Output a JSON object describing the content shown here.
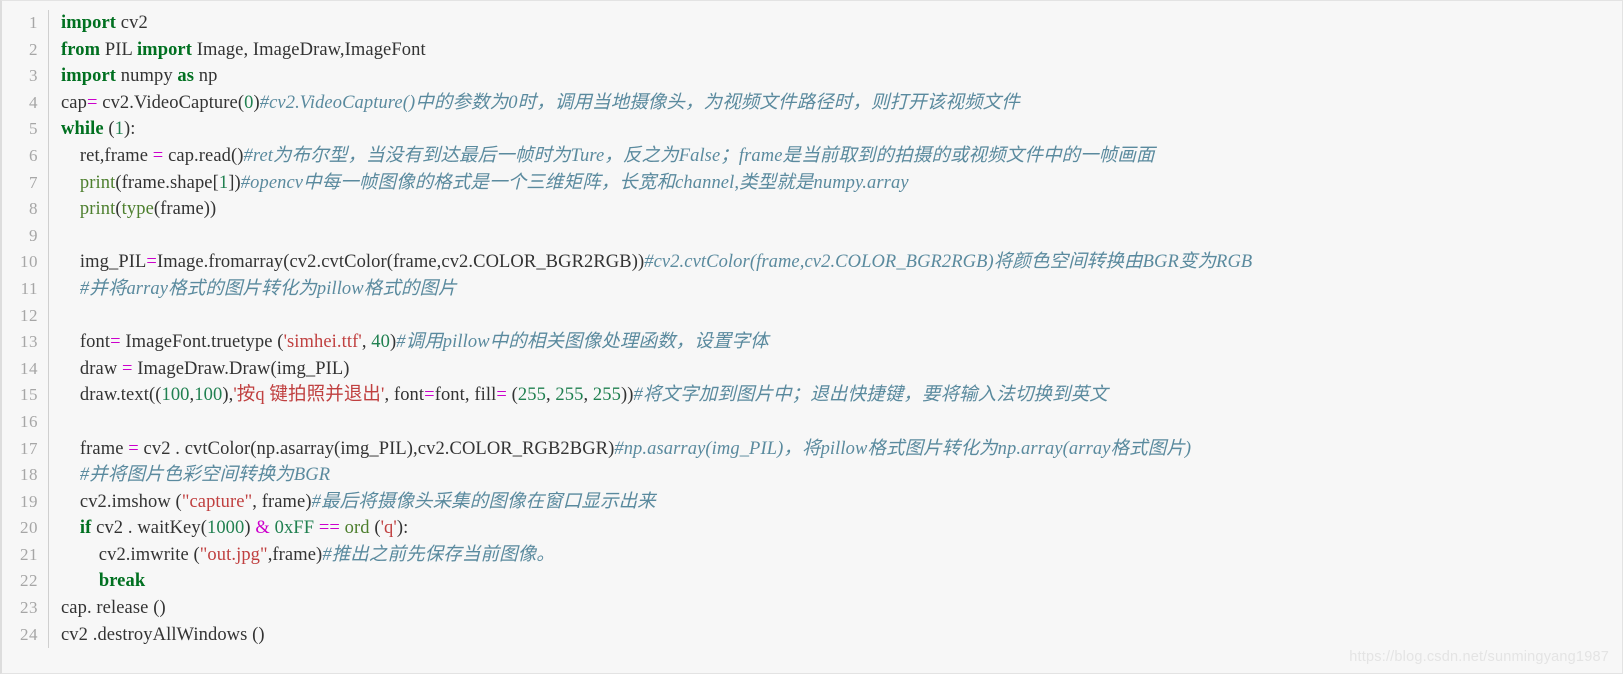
{
  "editor": {
    "language": "python",
    "total_lines": 24,
    "background_color": "#f7f7f7",
    "gutter_color": "#a6a6a6",
    "colors": {
      "keyword": "#007020",
      "builtin": "#4d7f2e",
      "number": "#208050",
      "string": "#c04040",
      "operator": "#cc00cc",
      "comment": "#5a8a9e",
      "plain": "#333333"
    },
    "line_numbers": [
      "1",
      "2",
      "3",
      "4",
      "5",
      "6",
      "7",
      "8",
      "9",
      "10",
      "11",
      "12",
      "13",
      "14",
      "15",
      "16",
      "17",
      "18",
      "19",
      "20",
      "21",
      "22",
      "23",
      "24"
    ],
    "lines": [
      {
        "n": "1",
        "tokens": [
          {
            "t": "import",
            "c": "kw"
          },
          {
            "t": " cv2",
            "c": "pl"
          }
        ]
      },
      {
        "n": "2",
        "tokens": [
          {
            "t": "from",
            "c": "kw"
          },
          {
            "t": " PIL ",
            "c": "pl"
          },
          {
            "t": "import",
            "c": "kw"
          },
          {
            "t": " Image, ImageDraw,ImageFont",
            "c": "pl"
          }
        ]
      },
      {
        "n": "3",
        "tokens": [
          {
            "t": "import",
            "c": "kw"
          },
          {
            "t": " numpy ",
            "c": "pl"
          },
          {
            "t": "as",
            "c": "kw"
          },
          {
            "t": " np",
            "c": "pl"
          }
        ]
      },
      {
        "n": "4",
        "tokens": [
          {
            "t": "cap",
            "c": "pl"
          },
          {
            "t": "=",
            "c": "op"
          },
          {
            "t": " cv2.VideoCapture(",
            "c": "pl"
          },
          {
            "t": "0",
            "c": "num"
          },
          {
            "t": ")",
            "c": "pl"
          },
          {
            "t": "#cv2.VideoCapture()中的参数为0时，调用当地摄像头，为视频文件路径时，则打开该视频文件",
            "c": "cmt"
          }
        ]
      },
      {
        "n": "5",
        "tokens": [
          {
            "t": "while",
            "c": "kw"
          },
          {
            "t": " (",
            "c": "pl"
          },
          {
            "t": "1",
            "c": "num"
          },
          {
            "t": "):",
            "c": "pl"
          }
        ]
      },
      {
        "n": "6",
        "tokens": [
          {
            "t": "    ret,frame ",
            "c": "pl"
          },
          {
            "t": "=",
            "c": "op"
          },
          {
            "t": " cap.read()",
            "c": "pl"
          },
          {
            "t": "#ret为布尔型，当没有到达最后一帧时为Ture，反之为False；frame是当前取到的拍摄的或视频文件中的一帧画面",
            "c": "cmt"
          }
        ]
      },
      {
        "n": "7",
        "tokens": [
          {
            "t": "    ",
            "c": "pl"
          },
          {
            "t": "print",
            "c": "bi"
          },
          {
            "t": "(frame.shape[",
            "c": "pl"
          },
          {
            "t": "1",
            "c": "num"
          },
          {
            "t": "])",
            "c": "pl"
          },
          {
            "t": "#opencv中每一帧图像的格式是一个三维矩阵，长宽和channel,类型就是numpy.array",
            "c": "cmt"
          }
        ]
      },
      {
        "n": "8",
        "tokens": [
          {
            "t": "    ",
            "c": "pl"
          },
          {
            "t": "print",
            "c": "bi"
          },
          {
            "t": "(",
            "c": "pl"
          },
          {
            "t": "type",
            "c": "bi"
          },
          {
            "t": "(frame))",
            "c": "pl"
          }
        ]
      },
      {
        "n": "9",
        "tokens": []
      },
      {
        "n": "10",
        "tokens": [
          {
            "t": "    img_PIL",
            "c": "pl"
          },
          {
            "t": "=",
            "c": "op"
          },
          {
            "t": "Image.fromarray(cv2.cvtColor(frame,cv2.COLOR_BGR2RGB))",
            "c": "pl"
          },
          {
            "t": "#cv2.cvtColor(frame,cv2.COLOR_BGR2RGB)将颜色空间转换由BGR变为RGB",
            "c": "cmt"
          }
        ]
      },
      {
        "n": "11",
        "tokens": [
          {
            "t": "    ",
            "c": "pl"
          },
          {
            "t": "#并将array格式的图片转化为pillow格式的图片",
            "c": "cmt"
          }
        ]
      },
      {
        "n": "12",
        "tokens": []
      },
      {
        "n": "13",
        "tokens": [
          {
            "t": "    font",
            "c": "pl"
          },
          {
            "t": "=",
            "c": "op"
          },
          {
            "t": " ImageFont.truetype (",
            "c": "pl"
          },
          {
            "t": "'simhei.ttf'",
            "c": "str"
          },
          {
            "t": ", ",
            "c": "pl"
          },
          {
            "t": "40",
            "c": "num"
          },
          {
            "t": ")",
            "c": "pl"
          },
          {
            "t": "#调用pillow中的相关图像处理函数，设置字体",
            "c": "cmt"
          }
        ]
      },
      {
        "n": "14",
        "tokens": [
          {
            "t": "    draw ",
            "c": "pl"
          },
          {
            "t": "=",
            "c": "op"
          },
          {
            "t": " ImageDraw.Draw(img_PIL)",
            "c": "pl"
          }
        ]
      },
      {
        "n": "15",
        "tokens": [
          {
            "t": "    draw.text((",
            "c": "pl"
          },
          {
            "t": "100",
            "c": "num"
          },
          {
            "t": ",",
            "c": "pl"
          },
          {
            "t": "100",
            "c": "num"
          },
          {
            "t": "),",
            "c": "pl"
          },
          {
            "t": "'按q 键拍照并退出'",
            "c": "str"
          },
          {
            "t": ", font",
            "c": "pl"
          },
          {
            "t": "=",
            "c": "op"
          },
          {
            "t": "font, fill",
            "c": "pl"
          },
          {
            "t": "=",
            "c": "op"
          },
          {
            "t": " (",
            "c": "pl"
          },
          {
            "t": "255",
            "c": "num"
          },
          {
            "t": ", ",
            "c": "pl"
          },
          {
            "t": "255",
            "c": "num"
          },
          {
            "t": ", ",
            "c": "pl"
          },
          {
            "t": "255",
            "c": "num"
          },
          {
            "t": "))",
            "c": "pl"
          },
          {
            "t": "#将文字加到图片中；退出快捷键，要将输入法切换到英文",
            "c": "cmt"
          }
        ]
      },
      {
        "n": "16",
        "tokens": []
      },
      {
        "n": "17",
        "tokens": [
          {
            "t": "    frame ",
            "c": "pl"
          },
          {
            "t": "=",
            "c": "op"
          },
          {
            "t": " cv2 . cvtColor(np.asarray(img_PIL),cv2.COLOR_RGB2BGR)",
            "c": "pl"
          },
          {
            "t": "#np.asarray(img_PIL)，将pillow格式图片转化为np.array(array格式图片)",
            "c": "cmt"
          }
        ]
      },
      {
        "n": "18",
        "tokens": [
          {
            "t": "    ",
            "c": "pl"
          },
          {
            "t": "#并将图片色彩空间转换为BGR",
            "c": "cmt"
          }
        ]
      },
      {
        "n": "19",
        "tokens": [
          {
            "t": "    cv2.imshow (",
            "c": "pl"
          },
          {
            "t": "\"capture\"",
            "c": "str"
          },
          {
            "t": ", frame)",
            "c": "pl"
          },
          {
            "t": "#最后将摄像头采集的图像在窗口显示出来",
            "c": "cmt"
          }
        ]
      },
      {
        "n": "20",
        "tokens": [
          {
            "t": "    ",
            "c": "pl"
          },
          {
            "t": "if",
            "c": "kw"
          },
          {
            "t": " cv2 . waitKey(",
            "c": "pl"
          },
          {
            "t": "1000",
            "c": "num"
          },
          {
            "t": ") ",
            "c": "pl"
          },
          {
            "t": "&",
            "c": "op"
          },
          {
            "t": " ",
            "c": "pl"
          },
          {
            "t": "0xFF",
            "c": "num"
          },
          {
            "t": " ",
            "c": "pl"
          },
          {
            "t": "==",
            "c": "op"
          },
          {
            "t": " ",
            "c": "pl"
          },
          {
            "t": "ord",
            "c": "bi"
          },
          {
            "t": " (",
            "c": "pl"
          },
          {
            "t": "'q'",
            "c": "str"
          },
          {
            "t": "):",
            "c": "pl"
          }
        ]
      },
      {
        "n": "21",
        "tokens": [
          {
            "t": "        cv2.imwrite (",
            "c": "pl"
          },
          {
            "t": "\"out.jpg\"",
            "c": "str"
          },
          {
            "t": ",frame)",
            "c": "pl"
          },
          {
            "t": "#推出之前先保存当前图像。",
            "c": "cmt"
          }
        ]
      },
      {
        "n": "22",
        "tokens": [
          {
            "t": "        ",
            "c": "pl"
          },
          {
            "t": "break",
            "c": "kw"
          }
        ]
      },
      {
        "n": "23",
        "tokens": [
          {
            "t": "cap. release ()",
            "c": "pl"
          }
        ]
      },
      {
        "n": "24",
        "tokens": [
          {
            "t": "cv2 .destroyAllWindows ()",
            "c": "pl"
          }
        ]
      }
    ]
  },
  "watermark": {
    "text": "https://blog.csdn.net/sunmingyang1987"
  }
}
